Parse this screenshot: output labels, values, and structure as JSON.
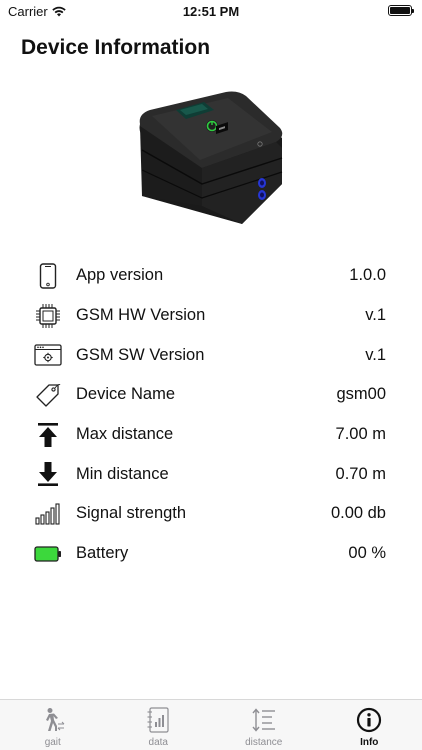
{
  "status_bar": {
    "carrier": "Carrier",
    "time": "12:51 PM"
  },
  "page": {
    "title": "Device Information"
  },
  "info_rows": [
    {
      "icon": "phone-icon",
      "label": "App version",
      "value": "1.0.0"
    },
    {
      "icon": "chip-icon",
      "label": "GSM HW Version",
      "value": "v.1"
    },
    {
      "icon": "software-window-icon",
      "label": "GSM SW Version",
      "value": "v.1"
    },
    {
      "icon": "tag-icon",
      "label": "Device Name",
      "value": "gsm00"
    },
    {
      "icon": "arrow-up-bar-icon",
      "label": "Max distance",
      "value": "7.00 m"
    },
    {
      "icon": "arrow-down-bar-icon",
      "label": "Min distance",
      "value": "0.70 m"
    },
    {
      "icon": "signal-bars-icon",
      "label": "Signal strength",
      "value": "0.00 db"
    },
    {
      "icon": "battery-icon",
      "label": "Battery",
      "value": "00 %"
    }
  ],
  "tab_bar": {
    "tabs": [
      {
        "label": "gait",
        "icon": "walking-person-icon",
        "active": false
      },
      {
        "label": "data",
        "icon": "notebook-chart-icon",
        "active": false
      },
      {
        "label": "distance",
        "icon": "vertical-distance-icon",
        "active": false
      },
      {
        "label": "Info",
        "icon": "info-circle-icon",
        "active": true
      }
    ]
  },
  "colors": {
    "battery_green": "#3cd83c",
    "accent_dark": "#111111",
    "tab_inactive": "#8e8e93",
    "device_led_green": "#2ecc40",
    "device_port_blue": "#2636d6"
  }
}
